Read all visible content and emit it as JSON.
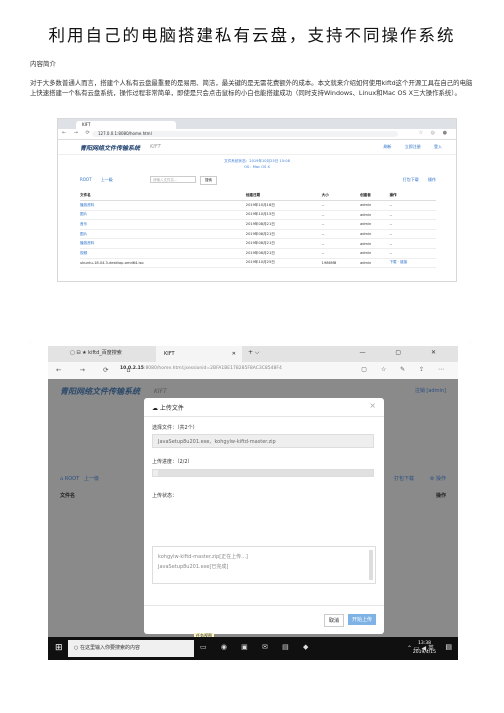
{
  "doc": {
    "title": "利用自己的电脑搭建私有云盘，支持不同操作系统",
    "section_heading": "内容简介",
    "paragraph": "对于大多数普通人而言，搭建个人私有云盘最重要的是易用、简洁，最关键的是无需花费额外的成本。本文就来介绍如何使用kiftd这个开源工具在自己的电脑上快速搭建一个私有云盘系统，操作过程非常简单，即使是只会点击鼠标的小白也能搭建成功（同时支持Windows、Linux和Mac OS X三大操作系统）。"
  },
  "shot1": {
    "tab_title": "KIFT",
    "url": "127.0.0.1:8080/home.html",
    "app_title": "青阳网络文件传输系统",
    "app_version": "KIFT",
    "header_links": [
      "刷新",
      "立即注册",
      "登入"
    ],
    "info_lines": [
      "文件系统状态：2019年10月25日 15:08",
      "OS：Mac OS X"
    ],
    "root_label": "ROOT",
    "up_label": "上一级",
    "search_placeholder": "请输入文件名...",
    "search_button": "搜索",
    "download_label": "打包下载",
    "ops_label": "操作",
    "columns": [
      "文件名",
      "创建日期",
      "大小",
      "创建者",
      "操作"
    ],
    "rows": [
      [
        "播放资料",
        "2019年10月16日",
        "--",
        "admin",
        "--"
      ],
      [
        "图片",
        "2019年10月15日",
        "--",
        "admin",
        "--"
      ],
      [
        "音乐",
        "2019年08月21日",
        "--",
        "admin",
        "--"
      ],
      [
        "图片",
        "2019年08月21日",
        "--",
        "admin",
        "--"
      ],
      [
        "播放资料",
        "2019年08月21日",
        "--",
        "admin",
        "--"
      ],
      [
        "视频",
        "2019年08月21日",
        "--",
        "admin",
        "--"
      ],
      [
        "ubuntu-18.04.3-desktop-amd64.iso",
        "2019年10月25日",
        "1986MB",
        "admin",
        "下载  · 链接"
      ]
    ]
  },
  "shot2": {
    "tab1_title": "kiftd_百度搜索",
    "tab2_title": "KIFT",
    "url_host": "10.0.2.15",
    "url_rest": ":8080/home.html;jsessionid=2BFA1BE178285F8AC3C8548F4",
    "app_title": "青阳网络文件传输系统",
    "app_version": "KIFT",
    "register_label": "注销 [admin]",
    "root_label": "ROOT",
    "up_label": "上一级",
    "file_col": "文件名",
    "download_label": "打包下载",
    "ops_label": "操作",
    "ops_col": "操作",
    "modal": {
      "title": "上传文件",
      "select_label": "选择文件：（共2个）",
      "selected_files": "JavaSetup8u201.exe、kohgylw-kiftd-master.zip",
      "progress_label": "上传进度：（2/2）",
      "progress_fraction": 1,
      "status_label": "上传状态：",
      "status_lines": [
        "kohgylw-kiftd-master.zip[正在上传...]",
        "JavaSetup8u201.exe[已完成]"
      ],
      "cancel_label": "取消",
      "start_label": "开始上传"
    },
    "hint_label": "任务视图",
    "taskbar": {
      "search_placeholder": "在这里输入你要搜索的内容",
      "ime_label": "英",
      "time": "13:38",
      "date": "2019/4/15"
    }
  }
}
